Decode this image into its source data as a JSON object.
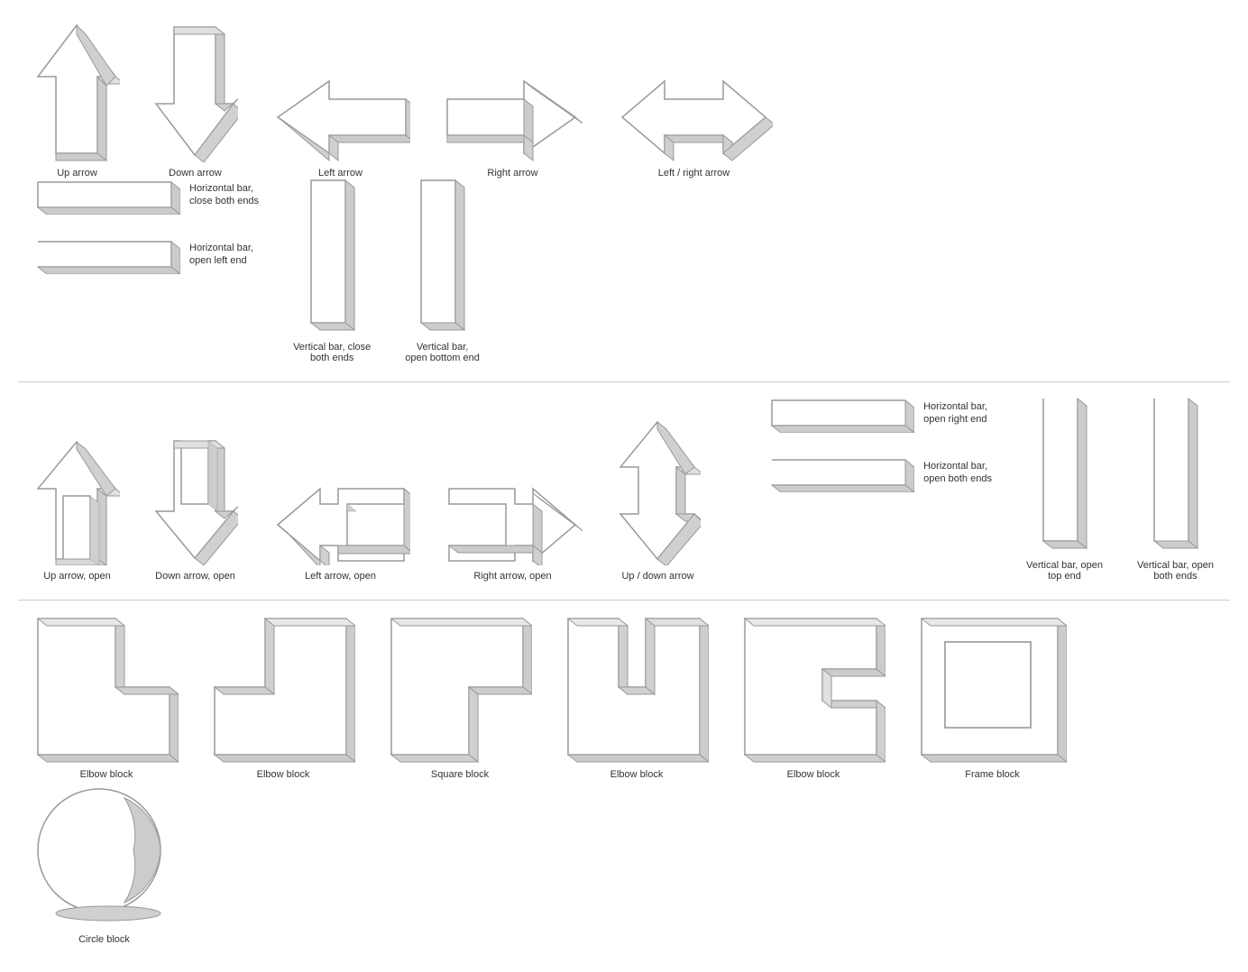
{
  "shapes": {
    "row1": [
      {
        "id": "up-arrow",
        "label": "Up arrow"
      },
      {
        "id": "down-arrow",
        "label": "Down arrow"
      },
      {
        "id": "left-arrow",
        "label": "Left arrow"
      },
      {
        "id": "right-arrow",
        "label": "Right arrow"
      },
      {
        "id": "left-right-arrow",
        "label": "Left / right arrow"
      }
    ],
    "row1_bars_top": [
      {
        "id": "hbar-close-both",
        "label": "Horizontal bar,\nclose both ends"
      },
      {
        "id": "hbar-open-left",
        "label": "Horizontal bar,\nopen left end"
      }
    ],
    "row1_bars_right": [
      {
        "id": "vbar-close-both",
        "label": "Vertical bar, close\nboth ends"
      },
      {
        "id": "vbar-open-bottom",
        "label": "Vertical bar,\nopen bottom end"
      }
    ],
    "row2": [
      {
        "id": "up-arrow-open",
        "label": "Up arrow, open"
      },
      {
        "id": "down-arrow-open",
        "label": "Down arrow,\nopen"
      },
      {
        "id": "left-arrow-open",
        "label": "Left arrow,\nopen"
      },
      {
        "id": "right-arrow-open",
        "label": "Right arrow,\nopen"
      },
      {
        "id": "up-down-arrow",
        "label": "Up / down\narrow"
      }
    ],
    "row2_bars": [
      {
        "id": "hbar-open-right",
        "label": "Horizontal bar,\nopen right end"
      },
      {
        "id": "hbar-open-both",
        "label": "Horizontal bar,\nopen both ends"
      }
    ],
    "row2_bars_right": [
      {
        "id": "vbar-open-top",
        "label": "Vertical bar, open\ntop end"
      },
      {
        "id": "vbar-open-both",
        "label": "Vertical bar, open\nboth ends"
      }
    ],
    "row3": [
      {
        "id": "elbow-block-1",
        "label": "Elbow block"
      },
      {
        "id": "elbow-block-2",
        "label": "Elbow block"
      },
      {
        "id": "square-block",
        "label": "Square block"
      },
      {
        "id": "elbow-block-3",
        "label": "Elbow block"
      },
      {
        "id": "elbow-block-4",
        "label": "Elbow block"
      },
      {
        "id": "frame-block",
        "label": "Frame block"
      },
      {
        "id": "circle-block",
        "label": "Circle block"
      }
    ]
  }
}
